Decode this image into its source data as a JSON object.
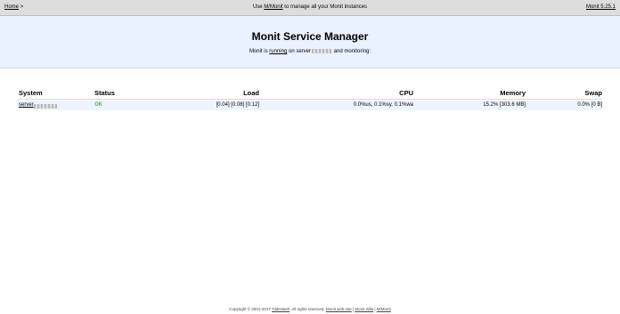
{
  "topbar": {
    "home_label": "Home",
    "home_sep": " >",
    "msg_prefix": "Use ",
    "mmonit_link": "M/Monit",
    "msg_suffix": " to manage all your Monit instances",
    "version_link": "Monit 5.25.1"
  },
  "header": {
    "title": "Monit Service Manager",
    "sub_prefix": "Monit is ",
    "sub_running": "running",
    "sub_middle": " on server",
    "sub_suffix": " and monitoring:"
  },
  "table": {
    "headers": {
      "system": "System",
      "status": "Status",
      "load": "Load",
      "cpu": "CPU",
      "memory": "Memory",
      "swap": "Swap"
    },
    "rows": [
      {
        "system": "server",
        "status": "OK",
        "load": "[0.04] [0.08] [0.12]",
        "cpu": "0.0%us, 0.1%sy, 0.1%wa",
        "memory": "15.2% [303.6 MB]",
        "swap": "0.0% [0 B]"
      }
    ]
  },
  "footer": {
    "copyright": "Copyright © 2001-2017 ",
    "tildeslash": "Tildeslash",
    "rights": ". All rights reserved.  ",
    "web_site": "Monit web site",
    "sep1": " | ",
    "wiki": "Monit Wiki",
    "sep2": " | ",
    "mmonit": "M/Monit"
  },
  "colors": {
    "ok": "#34c759",
    "header_bg": "#eaf1ff",
    "topbar_bg": "#dddddd"
  }
}
